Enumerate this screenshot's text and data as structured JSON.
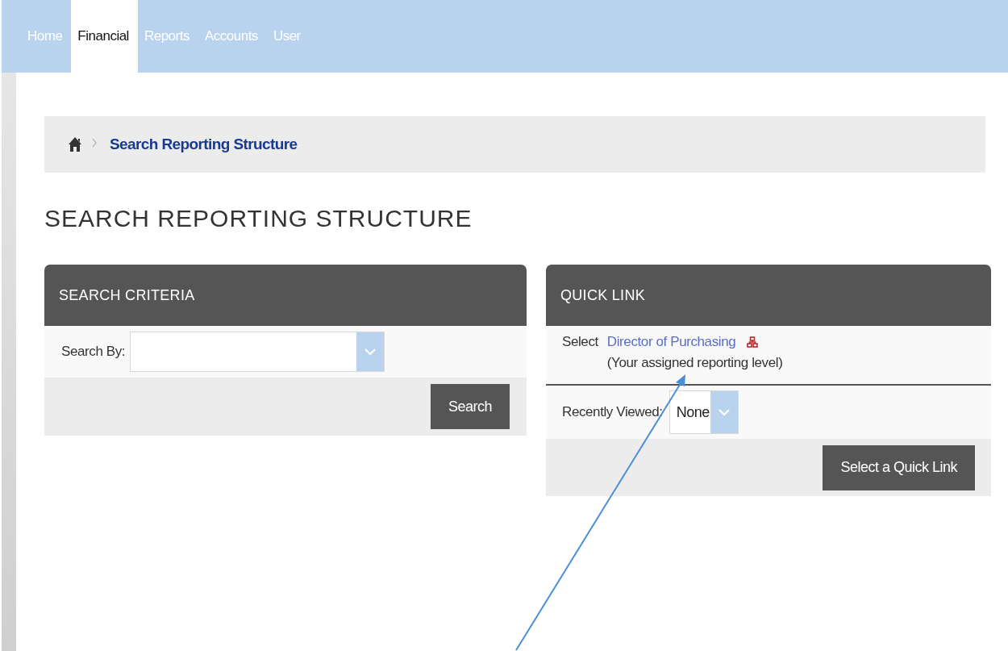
{
  "nav": {
    "tabs": [
      {
        "label": "Home",
        "selected": false
      },
      {
        "label": "Financial",
        "selected": true
      },
      {
        "label": "Reports",
        "selected": false
      },
      {
        "label": "Accounts",
        "selected": false
      },
      {
        "label": "User",
        "selected": false
      }
    ]
  },
  "breadcrumb": {
    "current": "Search Reporting Structure"
  },
  "page_title": "SEARCH REPORTING STRUCTURE",
  "search_criteria": {
    "title": "SEARCH CRITERIA",
    "search_by_label": "Search By:",
    "button": "Search"
  },
  "quick_link": {
    "title": "QUICK LINK",
    "select_label": "Select",
    "link": "Director of Purchasing",
    "note": "(Your assigned reporting level)",
    "recently_viewed_label": "Recently Viewed:",
    "recently_viewed_value": "None",
    "button": "Select a Quick Link"
  }
}
